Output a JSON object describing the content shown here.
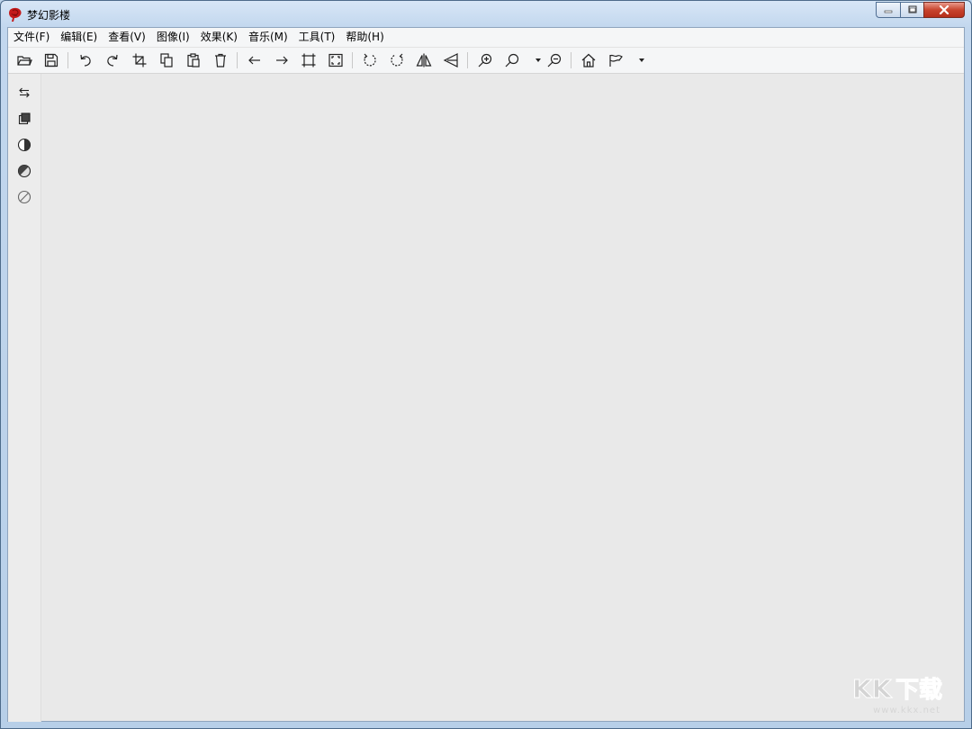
{
  "window": {
    "title": "梦幻影楼",
    "icon": "red-rose-icon"
  },
  "caption_buttons": [
    "minimize-icon",
    "maximize-icon",
    "close-icon"
  ],
  "menu": {
    "items": [
      "文件(F)",
      "编辑(E)",
      "查看(V)",
      "图像(I)",
      "效果(K)",
      "音乐(M)",
      "工具(T)",
      "帮助(H)"
    ]
  },
  "toolbar": {
    "buttons": [
      "open-folder-icon",
      "save-icon",
      "undo-icon",
      "redo-icon",
      "crop-icon",
      "copy-icon",
      "paste-icon",
      "delete-icon",
      "arrow-left-icon",
      "arrow-right-icon",
      "fit-window-icon",
      "fullscreen-icon",
      "rotate-left-icon",
      "rotate-right-icon",
      "flip-horizontal-icon",
      "flip-vertical-icon",
      "zoom-in-icon",
      "zoom-icon",
      "zoom-out-icon",
      "home-icon",
      "flag-icon"
    ],
    "dropdowns": [
      "zoom-dropdown",
      "flag-dropdown"
    ]
  },
  "sidebar": {
    "buttons": [
      "swap-icon",
      "layers-icon",
      "half-contrast-icon",
      "brightness-icon",
      "no-filter-icon"
    ]
  },
  "watermark": {
    "text": "KK下载",
    "url": "www.kkx.net"
  },
  "colors": {
    "window_frame": "#bcd3ea",
    "canvas": "#e9e9e9",
    "close_button": "#c8442d",
    "logo_red": "#c41a1a"
  }
}
